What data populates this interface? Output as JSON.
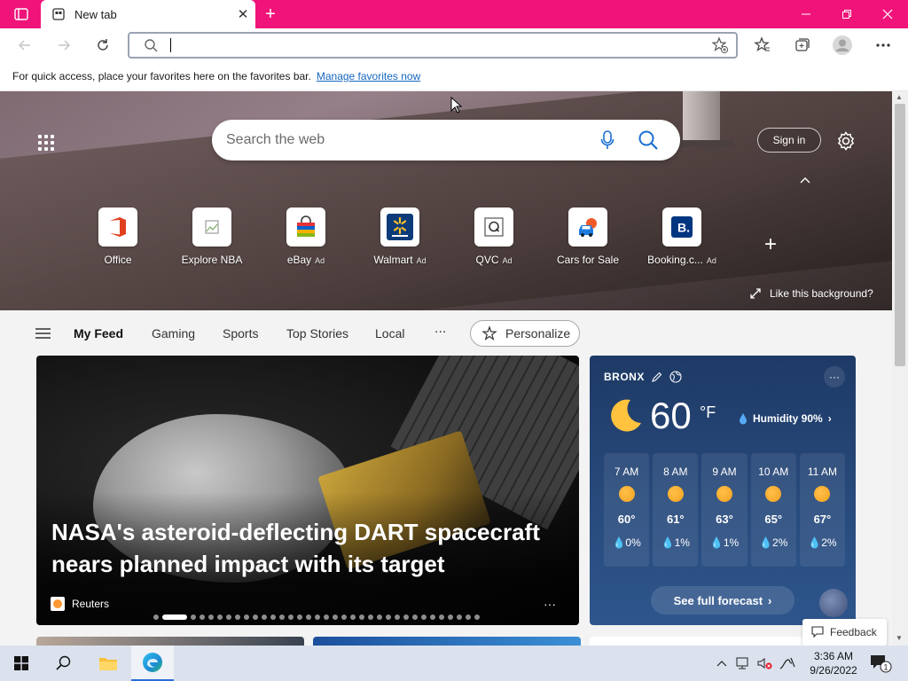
{
  "browser": {
    "tab_title": "New tab",
    "address_value": "",
    "favbar_text": "For quick access, place your favorites here on the favorites bar.",
    "favbar_link": "Manage favorites now"
  },
  "hero": {
    "search_placeholder": "Search the web",
    "signin_label": "Sign in",
    "like_background": "Like this background?",
    "quicklinks": [
      {
        "label": "Office",
        "ad": "",
        "icon": "office-icon"
      },
      {
        "label": "Explore NBA",
        "ad": "",
        "icon": "nba-icon"
      },
      {
        "label": "eBay",
        "ad": "Ad",
        "icon": "ebay-icon"
      },
      {
        "label": "Walmart",
        "ad": "Ad",
        "icon": "walmart-icon"
      },
      {
        "label": "QVC",
        "ad": "Ad",
        "icon": "qvc-icon"
      },
      {
        "label": "Cars for Sale",
        "ad": "",
        "icon": "car-icon"
      },
      {
        "label": "Booking.c...",
        "ad": "Ad",
        "icon": "booking-icon"
      }
    ]
  },
  "feed": {
    "nav": [
      "My Feed",
      "Gaming",
      "Sports",
      "Top Stories",
      "Local"
    ],
    "more": "...",
    "personalize": "Personalize",
    "headline": "NASA's asteroid-deflecting DART spacecraft nears planned impact with its target",
    "source": "Reuters",
    "carousel_count": 35,
    "carousel_active": 2
  },
  "weather": {
    "location": "BRONX",
    "temp": "60",
    "unit": "°F",
    "humidity": "Humidity 90%",
    "hours": [
      {
        "time": "7 AM",
        "temp": "60°",
        "precip": "0%"
      },
      {
        "time": "8 AM",
        "temp": "61°",
        "precip": "1%"
      },
      {
        "time": "9 AM",
        "temp": "63°",
        "precip": "1%"
      },
      {
        "time": "10 AM",
        "temp": "65°",
        "precip": "2%"
      },
      {
        "time": "11 AM",
        "temp": "67°",
        "precip": "2%"
      }
    ],
    "forecast_label": "See full forecast"
  },
  "feedback_label": "Feedback",
  "taskbar": {
    "time": "3:36 AM",
    "date": "9/26/2022",
    "notifications": "1"
  },
  "colors": {
    "titlebar": "#f0147a",
    "link": "#1666c0",
    "weather_bg": "#284a7c"
  }
}
